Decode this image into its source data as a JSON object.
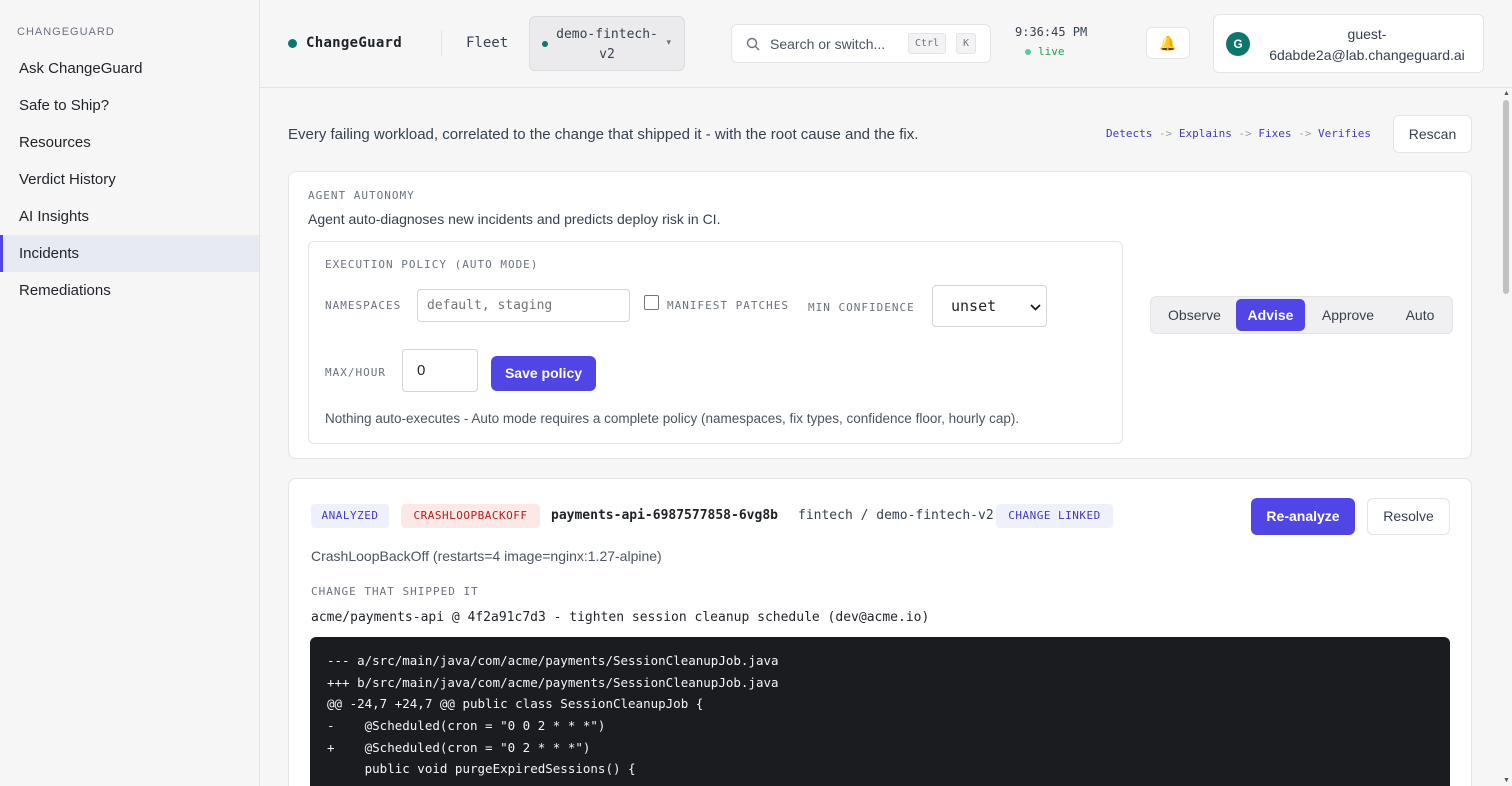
{
  "sidebar": {
    "brand": "CHANGEGUARD",
    "items": [
      {
        "label": "Ask ChangeGuard"
      },
      {
        "label": "Safe to Ship?"
      },
      {
        "label": "Resources"
      },
      {
        "label": "Verdict History"
      },
      {
        "label": "AI Insights"
      },
      {
        "label": "Incidents",
        "active": true
      },
      {
        "label": "Remediations"
      }
    ]
  },
  "header": {
    "logo": "ChangeGuard",
    "fleet": "Fleet",
    "cluster": "demo-fintech-v2",
    "search_placeholder": "Search or switch...",
    "kbd_ctrl": "Ctrl",
    "kbd_k": "K",
    "time": "9:36:45 PM",
    "live": "live",
    "user_initial": "G",
    "user_email": "guest-6dabde2a@lab.changeguard.ai"
  },
  "main": {
    "tagline": "Every failing workload, correlated to the change that shipped it - with the root cause and the fix.",
    "flow": [
      "Detects",
      "Explains",
      "Fixes",
      "Verifies"
    ],
    "flow_arrow": "->",
    "rescan_label": "Rescan"
  },
  "autonomy": {
    "title": "AGENT AUTONOMY",
    "description": "Agent auto-diagnoses new incidents and predicts deploy risk in CI.",
    "policy_title": "EXECUTION POLICY (AUTO MODE)",
    "namespaces_label": "NAMESPACES",
    "namespaces_placeholder": "default, staging",
    "manifest_label": "MANIFEST PATCHES",
    "min_conf_label": "MIN CONFIDENCE",
    "min_conf_value": "unset",
    "max_hour_label": "MAX/HOUR",
    "max_hour_value": "0",
    "save_label": "Save policy",
    "note": "Nothing auto-executes - Auto mode requires a complete policy (namespaces, fix types, confidence floor, hourly cap).",
    "modes": [
      "Observe",
      "Advise",
      "Approve",
      "Auto"
    ],
    "active_mode": "Advise"
  },
  "incident": {
    "status": "ANALYZED",
    "reason": "CRASHLOOPBACKOFF",
    "pod": "payments-api-6987577858-6vg8b",
    "location": "fintech / demo-fintech-v2",
    "link": "CHANGE LINKED",
    "reanalyze_label": "Re-analyze",
    "resolve_label": "Resolve",
    "detail": "CrashLoopBackOff (restarts=4 image=nginx:1.27-alpine)",
    "change_title": "CHANGE THAT SHIPPED IT",
    "commit": "acme/payments-api @ 4f2a91c7d3 - tighten session cleanup schedule (dev@acme.io)",
    "diff": [
      "--- a/src/main/java/com/acme/payments/SessionCleanupJob.java",
      "+++ b/src/main/java/com/acme/payments/SessionCleanupJob.java",
      "@@ -24,7 +24,7 @@ public class SessionCleanupJob {",
      "-    @Scheduled(cron = \"0 0 2 * * *\")",
      "+    @Scheduled(cron = \"0 2 * * *\")",
      "     public void purgeExpiredSessions() {"
    ]
  },
  "colors": {
    "accent": "#4f46e5",
    "live": "#10b981",
    "brand_dot": "#0f766e",
    "danger_bg": "#fde8e8",
    "danger_fg": "#b91c1c"
  }
}
